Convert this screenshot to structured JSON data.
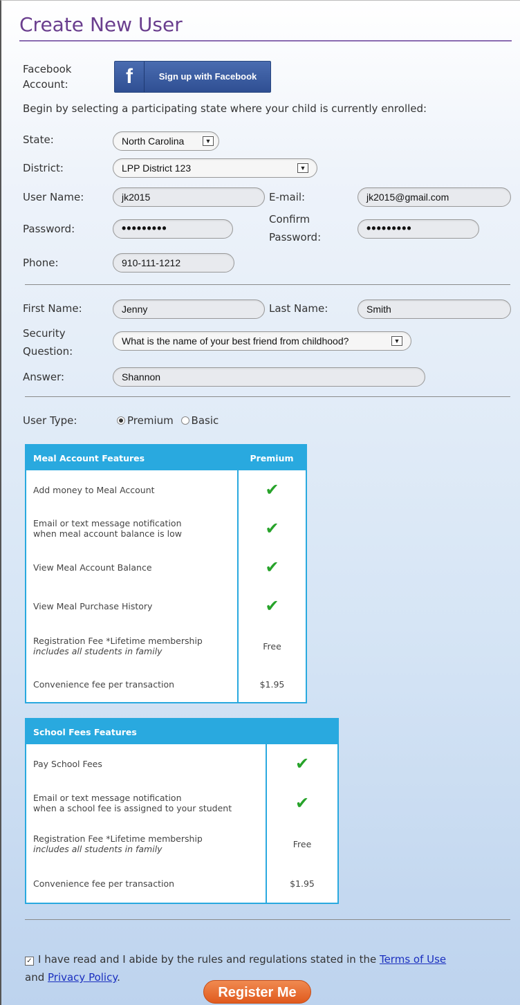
{
  "title": "Create New User",
  "facebook": {
    "label": "Facebook Account:",
    "button": "Sign up with Facebook",
    "icon": "facebook-icon"
  },
  "intro": "Begin by selecting a participating state where your child is currently enrolled:",
  "form": {
    "state_label": "State:",
    "state_value": "North Carolina",
    "district_label": "District:",
    "district_value": "LPP District 123",
    "username_label": "User Name:",
    "username_value": "jk2015",
    "email_label": "E-mail:",
    "email_value": "jk2015@gmail.com",
    "password_label": "Password:",
    "password_value": "•••••••••",
    "confirm_label_1": "Confirm",
    "confirm_label_2": "Password:",
    "confirm_value": "•••••••••",
    "phone_label": "Phone:",
    "phone_value": "910-111-1212",
    "first_label": "First Name:",
    "first_value": "Jenny",
    "last_label": "Last Name:",
    "last_value": "Smith",
    "security_label_1": "Security",
    "security_label_2": "Question:",
    "security_value": "What is the name of your best friend from childhood?",
    "answer_label": "Answer:",
    "answer_value": "Shannon",
    "usertype_label": "User Type:",
    "usertype_premium": "Premium",
    "usertype_basic": "Basic",
    "usertype_selected": "Premium"
  },
  "meal_table": {
    "header_feature": "Meal Account Features",
    "header_value": "Premium",
    "rows": [
      {
        "feature_1": "Add money to Meal Account",
        "feature_2": "",
        "value": "check"
      },
      {
        "feature_1": "Email or text message notification",
        "feature_2": "when meal account balance is low",
        "value": "check"
      },
      {
        "feature_1": "View Meal Account Balance",
        "feature_2": "",
        "value": "check"
      },
      {
        "feature_1": "View Meal Purchase History",
        "feature_2": "",
        "value": "check"
      },
      {
        "feature_1": "Registration Fee *Lifetime membership",
        "feature_2": "includes all students in family",
        "value": "Free"
      },
      {
        "feature_1": "Convenience fee per transaction",
        "feature_2": "",
        "value": "$1.95"
      }
    ]
  },
  "school_table": {
    "header_feature": "School Fees Features",
    "rows": [
      {
        "feature_1": "Pay School Fees",
        "feature_2": "",
        "value": "check"
      },
      {
        "feature_1": "Email or text message notification",
        "feature_2": "when a school fee is assigned to your student",
        "value": "check"
      },
      {
        "feature_1": "Registration Fee *Lifetime membership",
        "feature_2": "includes all students in family",
        "value": "Free"
      },
      {
        "feature_1": "Convenience fee per transaction",
        "feature_2": "",
        "value": "$1.95"
      }
    ]
  },
  "agreement": {
    "checked": true,
    "text_1": "I have read and I abide by the rules and regulations stated in the ",
    "terms_link": "Terms of Use",
    "text_2": "and ",
    "privacy_link": "Privacy Policy",
    "text_3": "."
  },
  "register_button": "Register Me",
  "colors": {
    "title": "#6a3e8e",
    "table_header": "#29a9df",
    "check": "#27a32a",
    "register": "#e05a1e",
    "facebook": "#3b5998"
  }
}
